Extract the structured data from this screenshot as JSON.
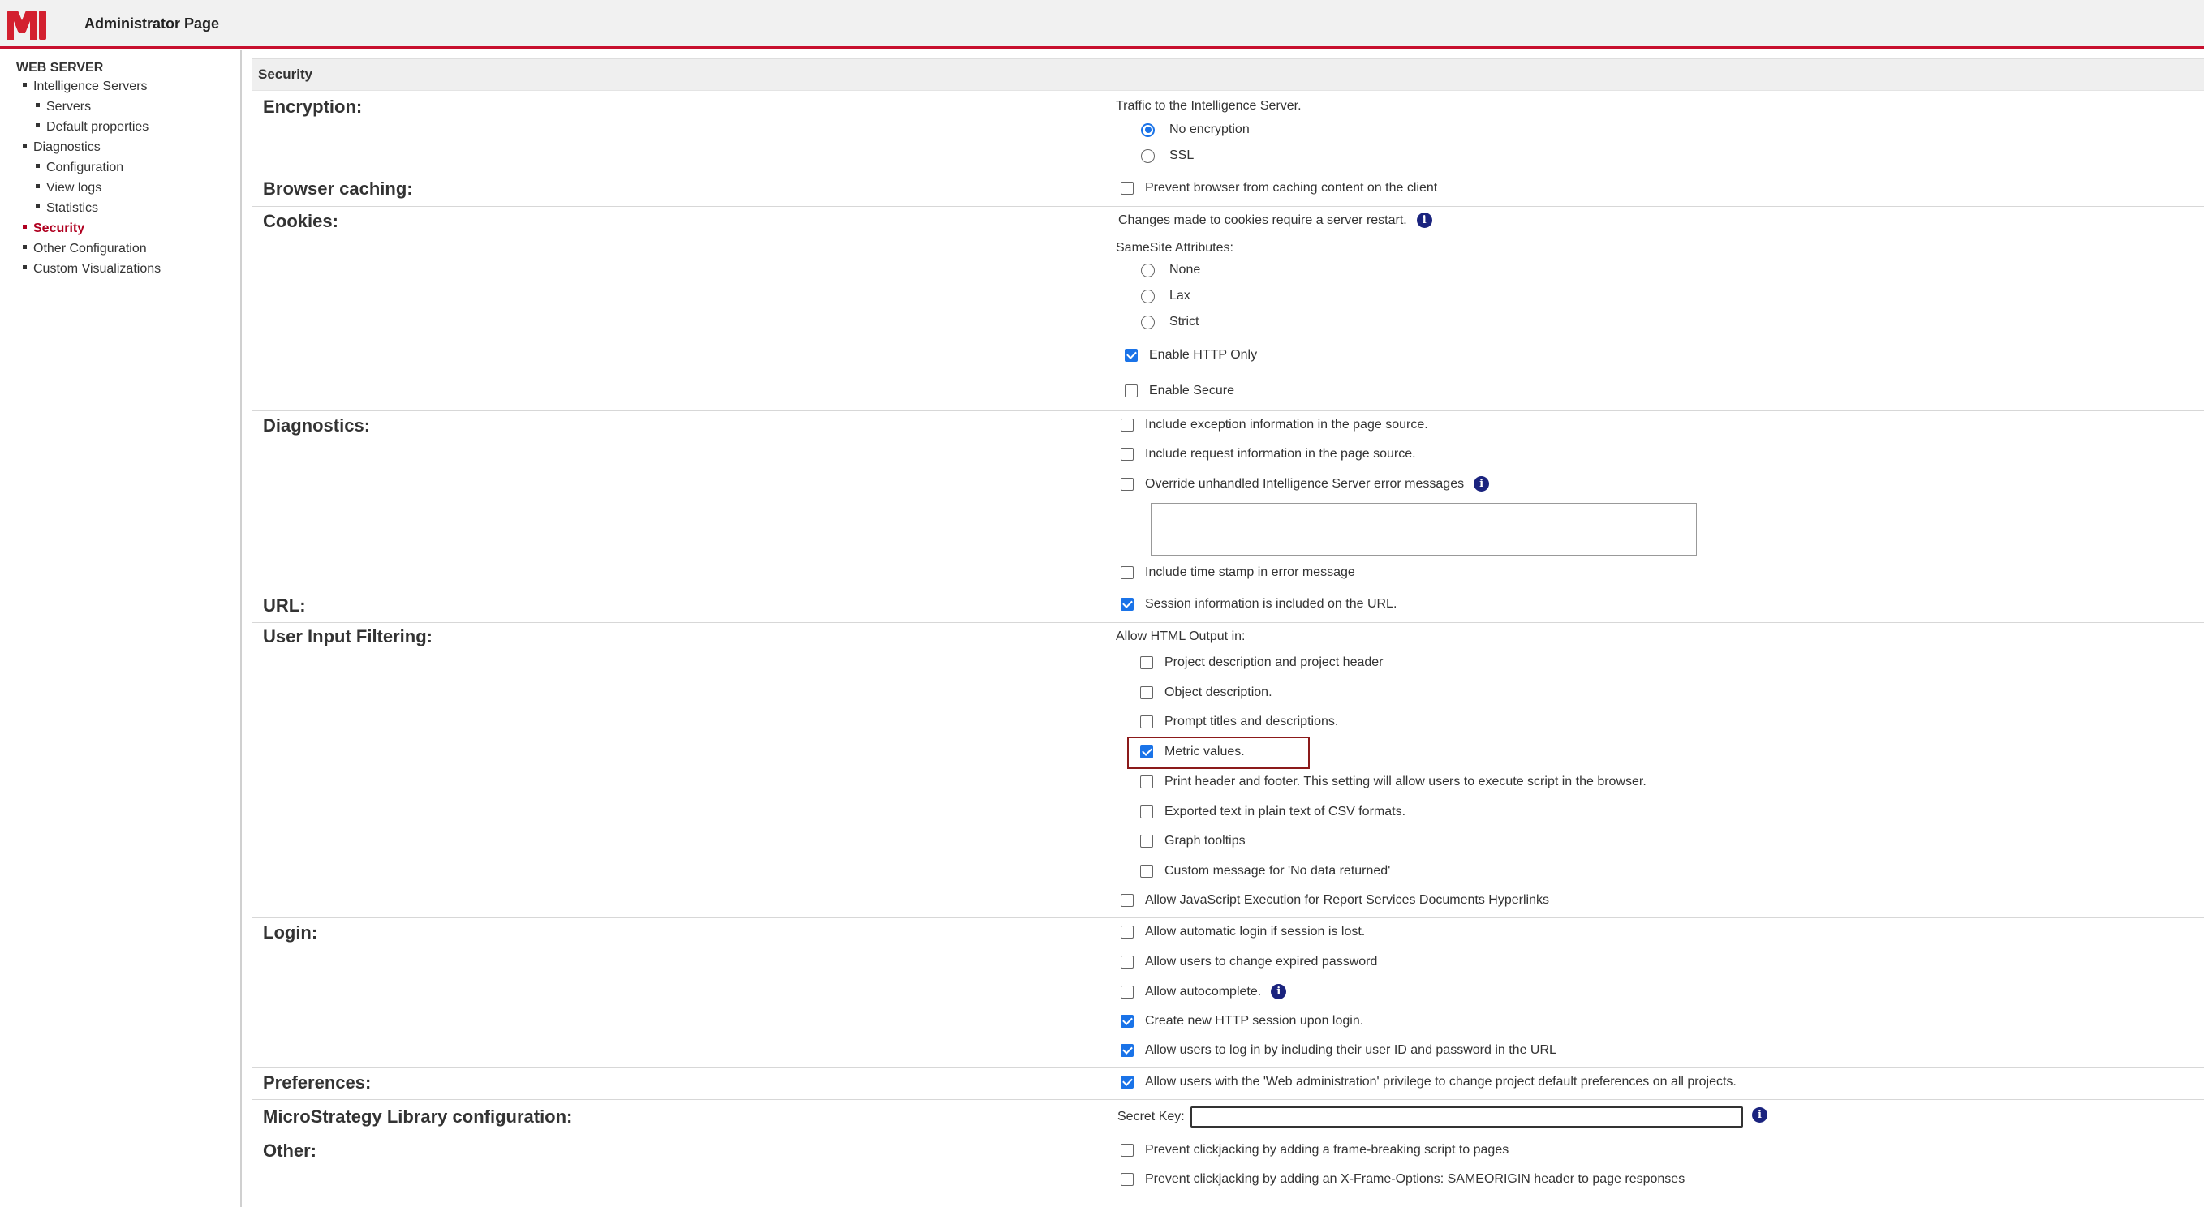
{
  "header": {
    "title": "Administrator Page",
    "logo_icon": "microstrategy-logo-icon",
    "accent_color": "#c8102e"
  },
  "sidebar": {
    "root": "WEB SERVER",
    "items": [
      {
        "label": "Intelligence Servers",
        "level": 1
      },
      {
        "label": "Servers",
        "level": 2
      },
      {
        "label": "Default properties",
        "level": 2
      },
      {
        "label": "Diagnostics",
        "level": 1
      },
      {
        "label": "Configuration",
        "level": 2
      },
      {
        "label": "View logs",
        "level": 2
      },
      {
        "label": "Statistics",
        "level": 2
      },
      {
        "label": "Security",
        "level": 1,
        "active": true
      },
      {
        "label": "Other Configuration",
        "level": 1
      },
      {
        "label": "Custom Visualizations",
        "level": 1
      }
    ]
  },
  "page": {
    "title": "Security"
  },
  "sections": {
    "encryption": {
      "label": "Encryption:",
      "caption": "Traffic to the Intelligence Server.",
      "options": [
        {
          "label": "No encryption",
          "selected": true
        },
        {
          "label": "SSL",
          "selected": false
        }
      ]
    },
    "browser_caching": {
      "label": "Browser caching:",
      "options": [
        {
          "label": "Prevent browser from caching content on the client",
          "checked": false
        }
      ]
    },
    "cookies": {
      "label": "Cookies:",
      "note": "Changes made to cookies require a server restart.",
      "samesite_caption": "SameSite Attributes:",
      "samesite_options": [
        {
          "label": "None",
          "selected": false
        },
        {
          "label": "Lax",
          "selected": false
        },
        {
          "label": "Strict",
          "selected": false
        }
      ],
      "http_only": {
        "label": "Enable HTTP Only",
        "checked": true
      },
      "secure": {
        "label": "Enable Secure",
        "checked": false
      }
    },
    "diagnostics": {
      "label": "Diagnostics:",
      "options": [
        {
          "label": "Include exception information in the page source.",
          "checked": false
        },
        {
          "label": "Include request information in the page source.",
          "checked": false
        },
        {
          "label": "Override unhandled Intelligence Server error messages",
          "checked": false
        },
        {
          "label": "Include time stamp in error message",
          "checked": false
        }
      ],
      "override_message_value": ""
    },
    "url": {
      "label": "URL:",
      "options": [
        {
          "label": "Session information is included on the URL.",
          "checked": true
        }
      ]
    },
    "user_input_filtering": {
      "label": "User Input Filtering:",
      "caption": "Allow HTML Output in:",
      "options": [
        {
          "label": "Project description and project header",
          "checked": false
        },
        {
          "label": "Object description.",
          "checked": false
        },
        {
          "label": "Prompt titles and descriptions.",
          "checked": false
        },
        {
          "label": "Metric values.",
          "checked": true
        },
        {
          "label": "Print header and footer. This setting will allow users to execute script in the browser.",
          "checked": false
        },
        {
          "label": "Exported text in plain text of CSV formats.",
          "checked": false
        },
        {
          "label": "Graph tooltips",
          "checked": false
        },
        {
          "label": "Custom message for 'No data returned'",
          "checked": false
        }
      ],
      "javascript_option": {
        "label": "Allow JavaScript Execution for Report Services Documents Hyperlinks",
        "checked": false
      }
    },
    "login": {
      "label": "Login:",
      "options": [
        {
          "label": "Allow automatic login if session is lost.",
          "checked": false
        },
        {
          "label": "Allow users to change expired password",
          "checked": false
        },
        {
          "label": "Allow autocomplete.",
          "checked": false
        },
        {
          "label": "Create new HTTP session upon login.",
          "checked": true
        },
        {
          "label": "Allow users to log in by including their user ID and password in the URL",
          "checked": true
        }
      ]
    },
    "preferences": {
      "label": "Preferences:",
      "options": [
        {
          "label": "Allow users with the 'Web administration' privilege to change project default preferences on all projects.",
          "checked": true
        }
      ]
    },
    "library": {
      "label": "MicroStrategy Library configuration:",
      "secret_key_label": "Secret Key:",
      "secret_key_value": ""
    },
    "other": {
      "label": "Other:",
      "options": [
        {
          "label": "Prevent clickjacking by adding a frame-breaking script to pages",
          "checked": false
        },
        {
          "label": "Prevent clickjacking by adding an X-Frame-Options: SAMEORIGIN header to page responses",
          "checked": false
        }
      ]
    }
  },
  "info_icon_glyph": "i",
  "colors": {
    "active_nav": "#b00020",
    "checkbox_checked": "#1a73e8",
    "highlight_box": "#8b1a1a",
    "info_icon": "#1a237e"
  }
}
